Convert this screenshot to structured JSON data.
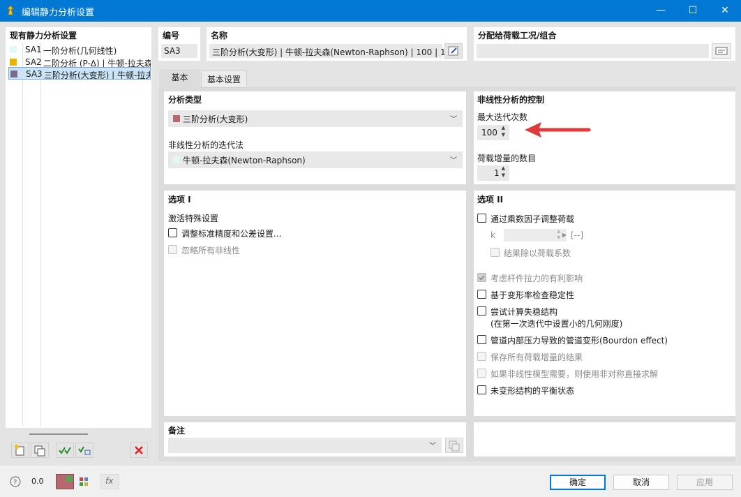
{
  "window": {
    "title": "编辑静力分析设置",
    "minimize": "—",
    "maximize": "☐",
    "close": "✕"
  },
  "left_panel": {
    "header": "现有静力分析设置",
    "items": [
      {
        "code": "SA1",
        "name": "一阶分析(几何线性)",
        "color": "#dff8f8"
      },
      {
        "code": "SA2",
        "name": "二阶分析 (P-Δ) | 牛顿-拉夫森",
        "color": "#e8b400"
      },
      {
        "code": "SA3",
        "name": "三阶分析(大变形) | 牛顿-拉夫",
        "color": "#7a6a8a"
      }
    ]
  },
  "header_fields": {
    "number_label": "编号",
    "number_value": "SA3",
    "name_label": "名称",
    "name_value": "三阶分析(大变形) | 牛顿-拉夫森(Newton-Raphson) | 100 | 1",
    "assign_label": "分配给荷载工况/组合",
    "assign_value": ""
  },
  "tabs": [
    {
      "label": "基本"
    },
    {
      "label": "基本设置"
    }
  ],
  "analysis_type": {
    "header": "分析类型",
    "type_value": "三阶分析(大变形)",
    "type_color": "#b5686e",
    "method_label": "非线性分析的迭代法",
    "method_value": "牛顿-拉夫森(Newton-Raphson)",
    "method_color": "#dff8f8"
  },
  "nonlinear_control": {
    "header": "非线性分析的控制",
    "max_iter_label": "最大迭代次数",
    "max_iter_value": "100",
    "load_inc_label": "荷载增量的数目",
    "load_inc_value": "1"
  },
  "options1": {
    "header": "选项 I",
    "activate_label": "激活特殊设置",
    "adjust_precision": "调整标准精度和公差设置...",
    "ignore_nonlinear": "忽略所有非线性"
  },
  "options2": {
    "header": "选项 II",
    "modify_loading": "通过乘数因子调整荷载",
    "k_label": "k",
    "k_value": "",
    "k_unit": "[--]",
    "divide_results": "结果除以荷载系数",
    "favorable_tension": "考虑杆件拉力的有利影响",
    "stiffness_stability": "基于变形率检查稳定性",
    "unstable_try": "尝试计算失稳结构",
    "unstable_try_sub": "(在第一次迭代中设置小的几何刚度)",
    "bourdon": "管道内部压力导致的管道变形(Bourdon effect)",
    "save_increments": "保存所有荷载增量的结果",
    "unsymmetric_solver": "如果非线性模型需要，则使用非对称直接求解",
    "undeformed_equilibrium": "未变形结构的平衡状态"
  },
  "comment": {
    "header": "备注",
    "value": ""
  },
  "buttons": {
    "ok": "确定",
    "cancel": "取消",
    "apply": "应用"
  },
  "bottom_toolbar": {
    "fx": "fx",
    "partial_text": "0.0"
  },
  "colors": {
    "accent": "#0078d4",
    "arrow": "#e03a3a",
    "delete": "#e02020"
  }
}
